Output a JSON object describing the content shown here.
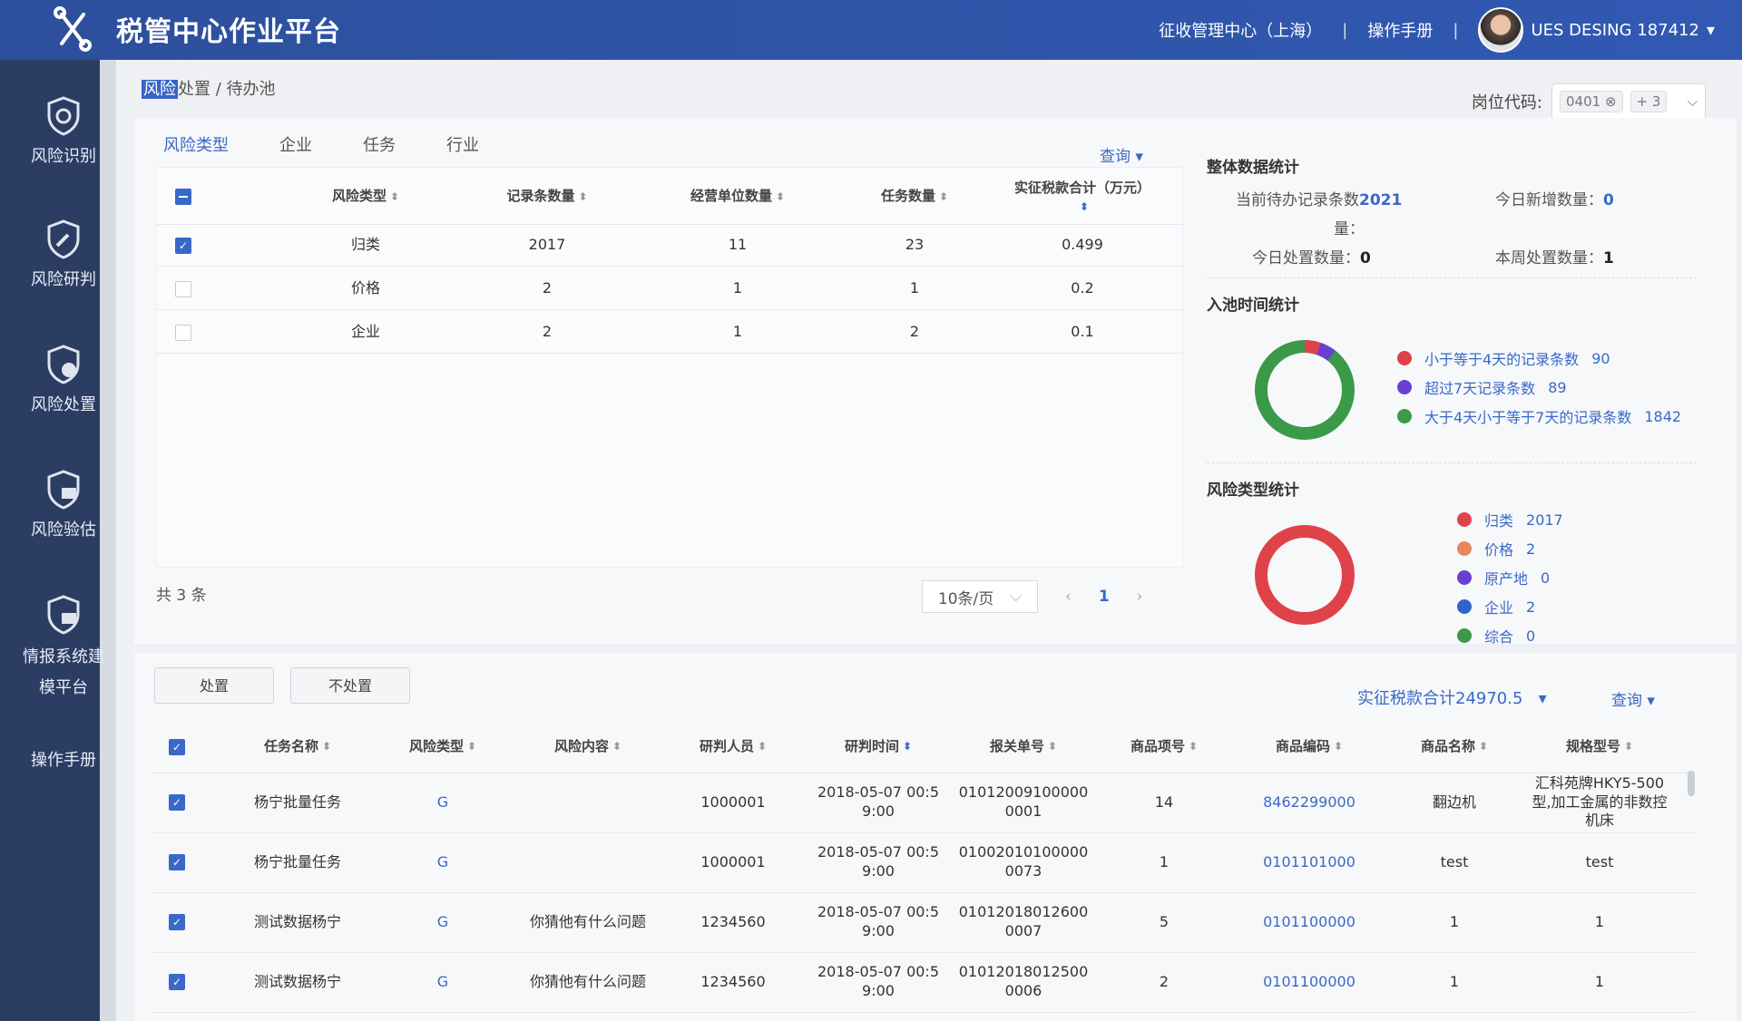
{
  "header": {
    "title": "税管中心作业平台",
    "center": "征收管理中心（上海）",
    "manual": "操作手册",
    "user": "UES DESING 187412"
  },
  "sidebar": {
    "items": [
      "风险识别",
      "风险研判",
      "风险处置",
      "风险验估",
      "情报系统建模平台",
      "操作手册"
    ]
  },
  "breadcrumb": {
    "part1": "风险",
    "part2": "处置",
    "part3": " / 待办池"
  },
  "post_code": {
    "label": "岗位代码:",
    "tag": "0401",
    "more": "+ 3"
  },
  "tabs": [
    "风险类型",
    "企业",
    "任务",
    "行业"
  ],
  "query_label": "查询",
  "risk_table": {
    "headers": [
      "风险类型",
      "记录条数量",
      "经营单位数量",
      "任务数量",
      "实征税款合计（万元）"
    ],
    "rows": [
      {
        "checked": true,
        "type": "归类",
        "records": "2017",
        "units": "11",
        "tasks": "23",
        "tax": "0.499"
      },
      {
        "checked": false,
        "type": "价格",
        "records": "2",
        "units": "1",
        "tasks": "1",
        "tax": "0.2"
      },
      {
        "checked": false,
        "type": "企业",
        "records": "2",
        "units": "1",
        "tasks": "2",
        "tax": "0.1"
      }
    ]
  },
  "total_text": "共 3 条",
  "pager": {
    "page_size": "10条/页",
    "current": "1",
    "prev": "‹",
    "next": "›"
  },
  "overall": {
    "title": "整体数据统计",
    "pending_label": "当前待办记录条数",
    "pending_value": "2021",
    "pending_suffix": "量：",
    "today_new_label": "今日新增数量：",
    "today_new_value": "0",
    "today_done_label": "今日处置数量：",
    "today_done_value": "0",
    "week_done_label": "本周处置数量：",
    "week_done_value": "1"
  },
  "pool_time": {
    "title": "入池时间统计",
    "items": [
      {
        "label": "小于等于4天的记录条数",
        "value": "90",
        "color": "#e0424a"
      },
      {
        "label": "超过7天记录条数",
        "value": "89",
        "color": "#6a3fd0"
      },
      {
        "label": "大于4天小于等于7天的记录条数",
        "value": "1842",
        "color": "#3a9a48"
      }
    ]
  },
  "risk_type_stats": {
    "title": "风险类型统计",
    "items": [
      {
        "label": "归类",
        "value": "2017",
        "color": "#e0424a"
      },
      {
        "label": "价格",
        "value": "2",
        "color": "#e8875a"
      },
      {
        "label": "原产地",
        "value": "0",
        "color": "#6a3fd0"
      },
      {
        "label": "企业",
        "value": "2",
        "color": "#3064c8"
      },
      {
        "label": "综合",
        "value": "0",
        "color": "#3a9a48"
      }
    ]
  },
  "actions": {
    "handle": "处置",
    "not_handle": "不处置",
    "sum_tax": "实征税款合计24970.5",
    "query": "查询"
  },
  "task_table": {
    "headers": [
      "任务名称",
      "风险类型",
      "风险内容",
      "研判人员",
      "研判时间",
      "报关单号",
      "商品项号",
      "商品编码",
      "商品名称",
      "规格型号"
    ],
    "rows": [
      {
        "name": "杨宁批量任务",
        "type": "G",
        "content": "",
        "person": "1000001",
        "time": "2018-05-07 00:59:00",
        "decl": "010120091000000001",
        "item": "14",
        "code": "8462299000",
        "goods": "翻边机",
        "spec": "汇科苑牌HKY5-500型,加工金属的非数控机床"
      },
      {
        "name": "杨宁批量任务",
        "type": "G",
        "content": "",
        "person": "1000001",
        "time": "2018-05-07 00:59:00",
        "decl": "010020101000000073",
        "item": "1",
        "code": "0101101000",
        "goods": "test",
        "spec": "test"
      },
      {
        "name": "测试数据杨宁",
        "type": "G",
        "content": "你猜他有什么问题",
        "person": "1234560",
        "time": "2018-05-07 00:59:00",
        "decl": "010120180126000007",
        "item": "5",
        "code": "0101100000",
        "goods": "1",
        "spec": "1"
      },
      {
        "name": "测试数据杨宁",
        "type": "G",
        "content": "你猜他有什么问题",
        "person": "1234560",
        "time": "2018-05-07 00:59:00",
        "decl": "010120180125000006",
        "item": "2",
        "code": "0101100000",
        "goods": "1",
        "spec": "1"
      }
    ]
  }
}
